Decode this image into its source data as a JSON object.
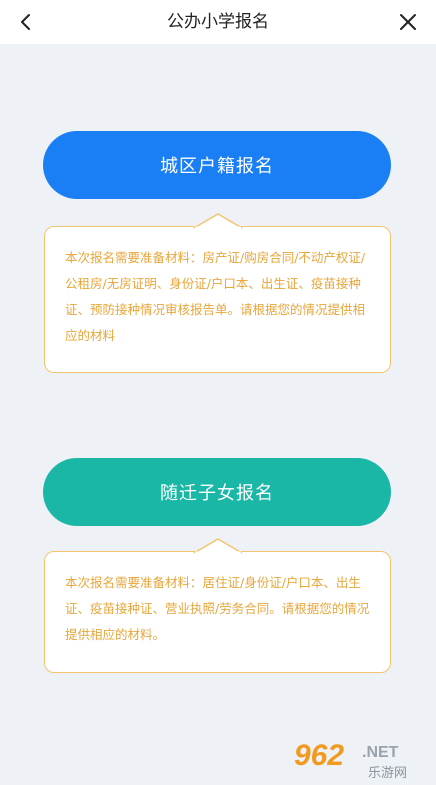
{
  "header": {
    "title": "公办小学报名"
  },
  "sections": [
    {
      "button_label": "城区户籍报名",
      "button_color": "#1a7ff5",
      "materials": "本次报名需要准备材料：房产证/购房合同/不动产权证/公租房/无房证明、身份证/户口本、出生证、疫苗接种证、预防接种情况审核报告单。请根据您的情况提供相应的材料"
    },
    {
      "button_label": "随迁子女报名",
      "button_color": "#1ab7a7",
      "materials": "本次报名需要准备材料：居住证/身份证/户口本、出生证、疫苗接种证、营业执照/劳务合同。请根据您的情况提供相应的材料。"
    }
  ],
  "colors": {
    "accent_border": "#f3c46f",
    "material_text": "#e8a63b"
  },
  "watermark": {
    "number": "962",
    "suffix": ".NET",
    "site_name": "乐游网"
  }
}
